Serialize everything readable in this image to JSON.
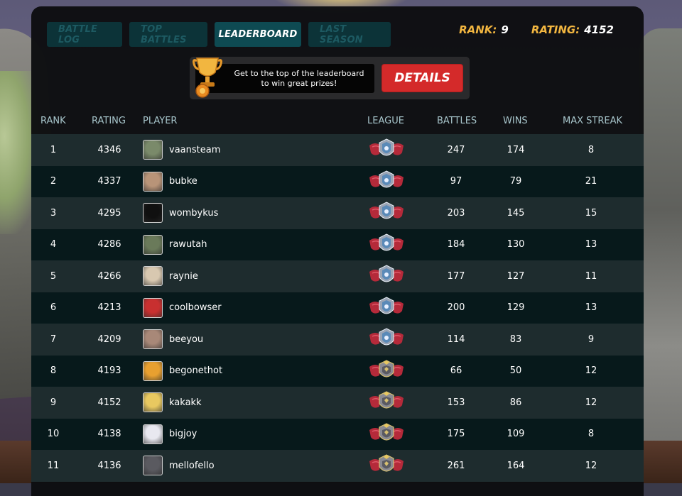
{
  "tabs": [
    {
      "label": "BATTLE LOG",
      "active": false
    },
    {
      "label": "TOP BATTLES",
      "active": false
    },
    {
      "label": "LEADERBOARD",
      "active": true
    },
    {
      "label": "LAST SEASON",
      "active": false
    }
  ],
  "stats": {
    "rank_label": "RANK:",
    "rank_value": "9",
    "rating_label": "RATING:",
    "rating_value": "4152"
  },
  "promo": {
    "line1": "Get to the top of the leaderboard",
    "line2": "to win great prizes!",
    "button_label": "DETAILS"
  },
  "columns": {
    "rank": "RANK",
    "rating": "RATING",
    "player": "PLAYER",
    "league": "LEAGUE",
    "battles": "BATTLES",
    "wins": "WINS",
    "max_streak": "MAX STREAK"
  },
  "rows": [
    {
      "rank": "1",
      "rating": "4346",
      "player": "vaansteam",
      "battles": "247",
      "wins": "174",
      "max_streak": "8",
      "avatar_color": "#7a8a6a",
      "league_icon": "champion-badge-icon"
    },
    {
      "rank": "2",
      "rating": "4337",
      "player": "bubke",
      "battles": "97",
      "wins": "79",
      "max_streak": "21",
      "avatar_color": "#b89478",
      "league_icon": "champion-badge-icon"
    },
    {
      "rank": "3",
      "rating": "4295",
      "player": "wombykus",
      "battles": "203",
      "wins": "145",
      "max_streak": "15",
      "avatar_color": "#101010",
      "league_icon": "champion-badge-icon"
    },
    {
      "rank": "4",
      "rating": "4286",
      "player": "rawutah",
      "battles": "184",
      "wins": "130",
      "max_streak": "13",
      "avatar_color": "#6a7a5a",
      "league_icon": "champion-badge-icon"
    },
    {
      "rank": "5",
      "rating": "4266",
      "player": "raynie",
      "battles": "177",
      "wins": "127",
      "max_streak": "11",
      "avatar_color": "#d8c8b0",
      "league_icon": "champion-badge-icon"
    },
    {
      "rank": "6",
      "rating": "4213",
      "player": "coolbowser",
      "battles": "200",
      "wins": "129",
      "max_streak": "13",
      "avatar_color": "#c83030",
      "league_icon": "champion-badge-icon"
    },
    {
      "rank": "7",
      "rating": "4209",
      "player": "beeyou",
      "battles": "114",
      "wins": "83",
      "max_streak": "9",
      "avatar_color": "#a88878",
      "league_icon": "champion-badge-icon"
    },
    {
      "rank": "8",
      "rating": "4193",
      "player": "begonethot",
      "battles": "66",
      "wins": "50",
      "max_streak": "12",
      "avatar_color": "#e8a030",
      "league_icon": "diamond-badge-icon"
    },
    {
      "rank": "9",
      "rating": "4152",
      "player": "kakakk",
      "battles": "153",
      "wins": "86",
      "max_streak": "12",
      "avatar_color": "#e8c860",
      "league_icon": "diamond-badge-icon"
    },
    {
      "rank": "10",
      "rating": "4138",
      "player": "bigjoy",
      "battles": "175",
      "wins": "109",
      "max_streak": "8",
      "avatar_color": "#e8e8f0",
      "league_icon": "diamond-badge-icon"
    },
    {
      "rank": "11",
      "rating": "4136",
      "player": "mellofello",
      "battles": "261",
      "wins": "164",
      "max_streak": "12",
      "avatar_color": "#5a5a60",
      "league_icon": "diamond-badge-icon"
    }
  ],
  "colors": {
    "accent_gold": "#f2b640",
    "details_red": "#d42a2a",
    "tab_active": "#0e4a52",
    "tab_inactive": "#0c3338"
  }
}
